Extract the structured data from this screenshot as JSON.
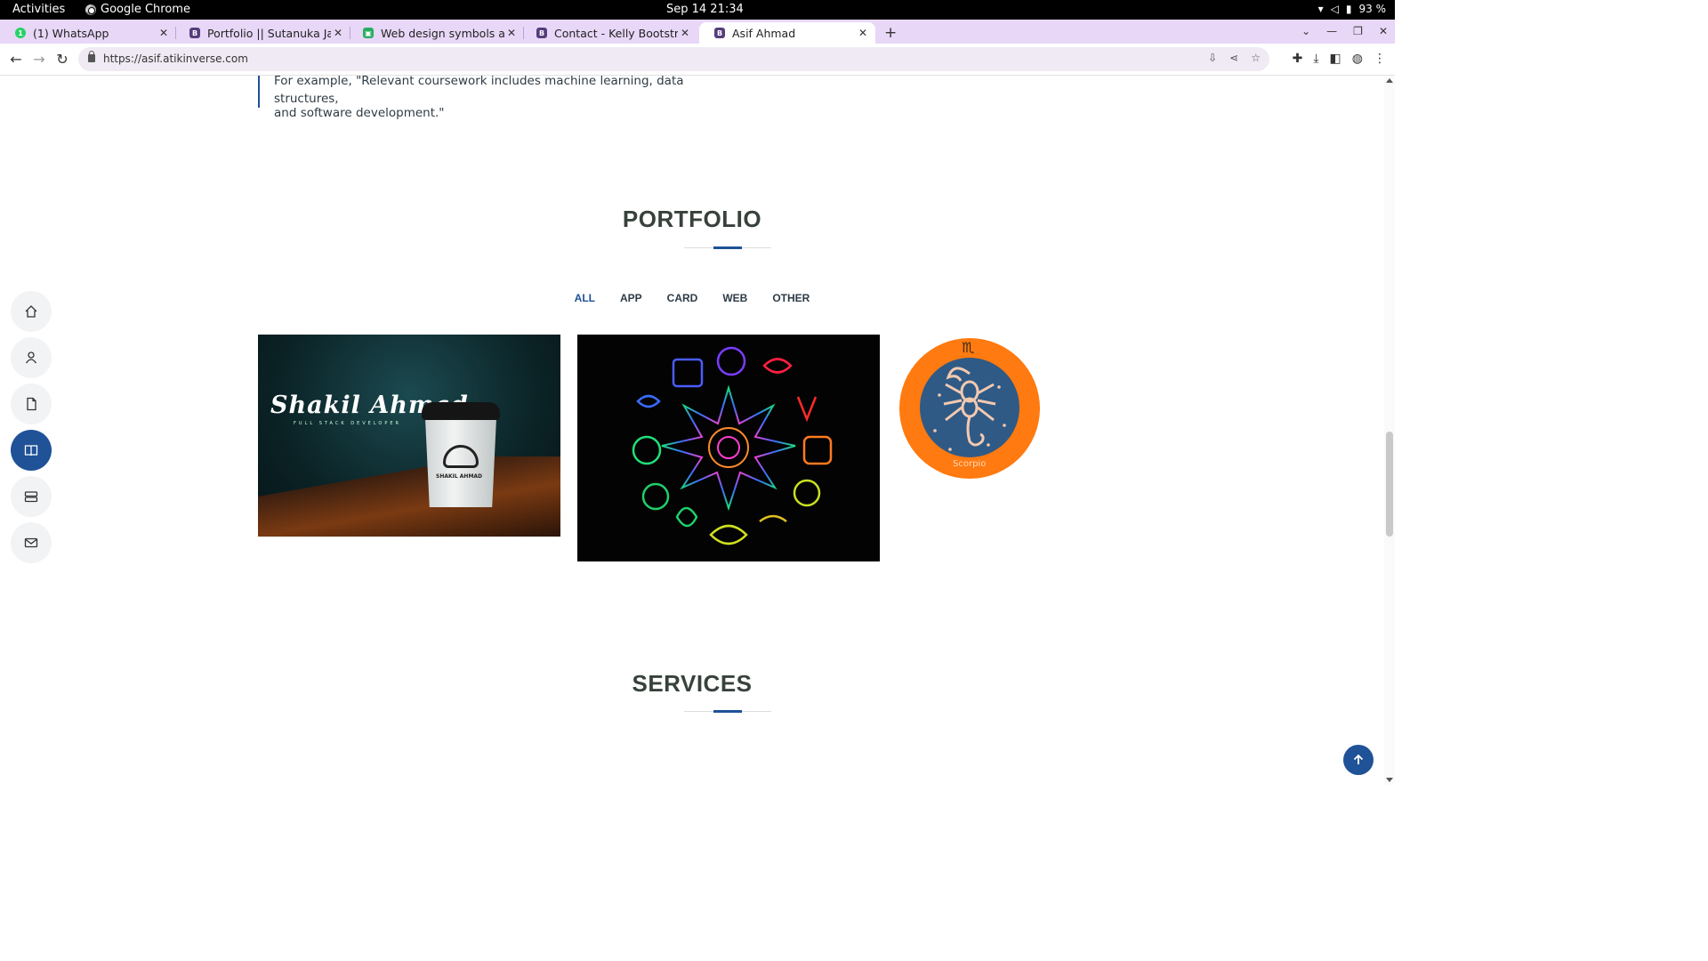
{
  "system_bar": {
    "activities": "Activities",
    "app_name": "Google Chrome",
    "clock": "Sep 14  21:34",
    "battery": "93 %"
  },
  "tabs": [
    {
      "title": "(1) WhatsApp",
      "favicon": "whatsapp-icon",
      "favicon_color": "#25d366"
    },
    {
      "title": "Portfolio || Sutanuka Jana",
      "favicon": "bootstrap-icon",
      "favicon_color": "#563d7c"
    },
    {
      "title": "Web design symbols and icons",
      "favicon": "sheet-icon",
      "favicon_color": "#27ae60"
    },
    {
      "title": "Contact - Kelly Bootstrap",
      "favicon": "bootstrap-icon",
      "favicon_color": "#563d7c"
    },
    {
      "title": "Asif Ahmad",
      "favicon": "bootstrap-icon",
      "favicon_color": "#563d7c",
      "active": true
    }
  ],
  "address_bar": {
    "url": "https://asif.atikinverse.com"
  },
  "page": {
    "quote_line1": "For example, \"Relevant coursework includes machine learning, data structures,",
    "quote_line2": "and software development.\"",
    "portfolio_title": "PORTFOLIO",
    "filters": [
      "ALL",
      "APP",
      "CARD",
      "WEB",
      "OTHER"
    ],
    "active_filter": "ALL",
    "card1_name": "Shakil Ahmad",
    "card1_sub": "FULL STACK DEVELOPER",
    "card1_cup_text": "SHAKIL AHMAD",
    "card3_label": "Scorpio",
    "card3_symbol": "♏",
    "services_title": "SERVICES"
  },
  "side_nav": [
    "home-icon",
    "person-icon",
    "file-icon",
    "book-icon",
    "server-icon",
    "envelope-icon"
  ],
  "side_nav_active": "book-icon",
  "colors": {
    "accent": "#1f5297",
    "tab_strip": "#e8d7f7",
    "scorpio_ring": "#ff7a10",
    "scorpio_inner": "#2f5a86"
  }
}
